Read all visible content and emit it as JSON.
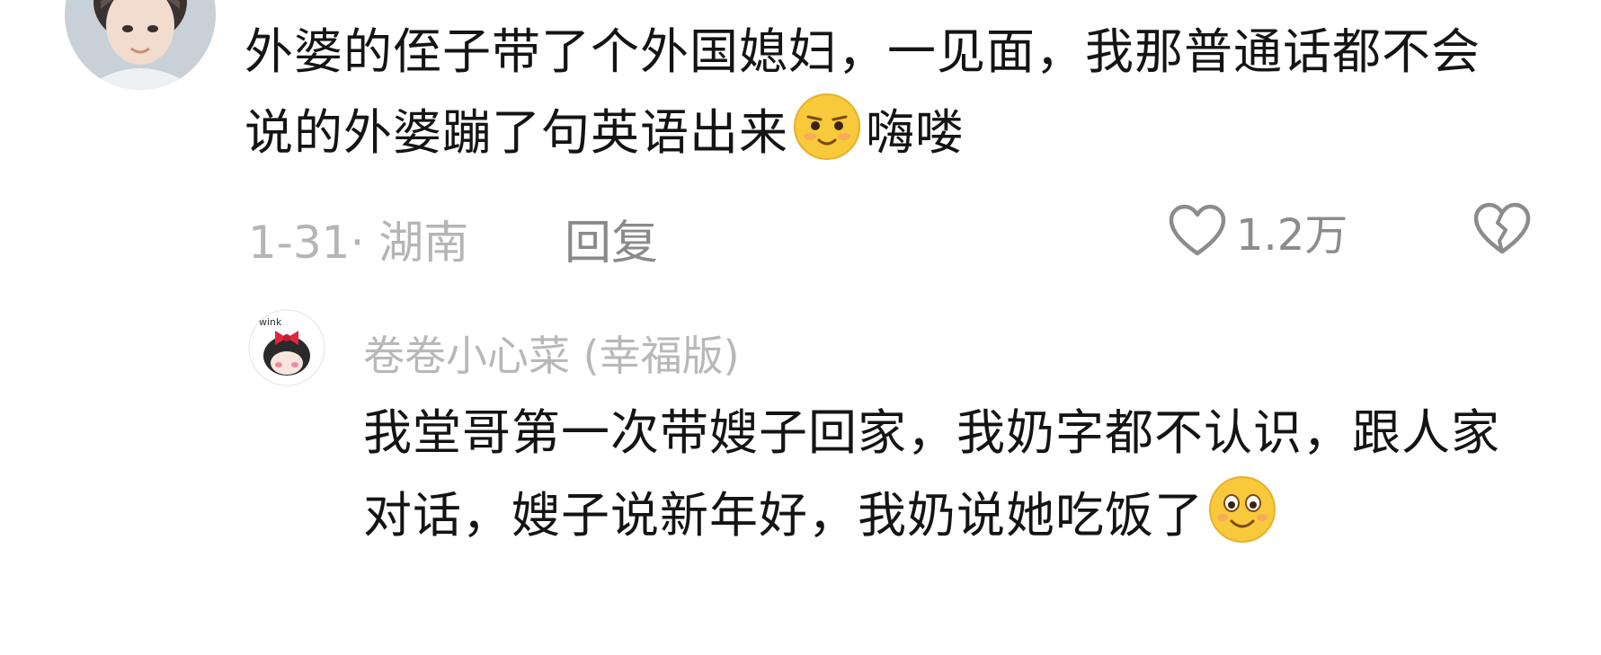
{
  "comment": {
    "text_part1": "外婆的侄子带了个外国媳妇，一见面，我那普通话都不会说的外婆蹦了句英语出来",
    "emoji_inline": "smirk-emoji",
    "text_part2": "嗨喽",
    "date_location": "1-31· 湖南",
    "reply_label": "回复",
    "like_count": "1.2万"
  },
  "reply": {
    "username": "卷卷小心菜 (幸福版)",
    "avatar_badge": "wink",
    "text": "我堂哥第一次带嫂子回家，我奶字都不认识，跟人家对话，嫂子说新年好，我奶说她吃饭了",
    "emoji_inline": "smile-emoji"
  },
  "colors": {
    "text_primary": "#141414",
    "text_meta": "#b5b5b5",
    "text_reply_btn": "#8a8a8a",
    "emoji_yellow": "#f8c93a"
  }
}
